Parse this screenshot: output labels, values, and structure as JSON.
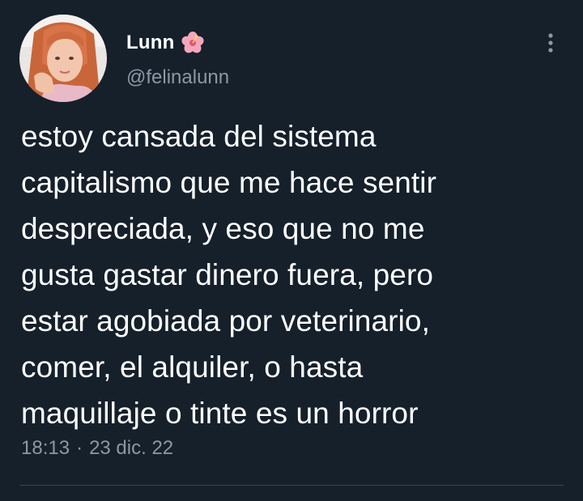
{
  "author": {
    "display_name": "Lunn",
    "name_emoji": "hibiscus-icon",
    "handle": "@felinalunn"
  },
  "tweet": {
    "lines": [
      "estoy cansada del sistema",
      "capitalismo que me hace sentir",
      "despreciada, y eso que no me",
      "gusta gastar dinero fuera, pero",
      "estar agobiada por veterinario,",
      "comer, el alquiler, o hasta",
      "maquillaje o tinte es un horror"
    ],
    "time": "18:13",
    "separator": "·",
    "date": "23 dic. 22"
  },
  "colors": {
    "background": "#15202b",
    "primary_text": "#ffffff",
    "secondary_text": "#8b98a5",
    "divider": "#38444d"
  },
  "icons": {
    "more": "more-vertical-icon"
  }
}
